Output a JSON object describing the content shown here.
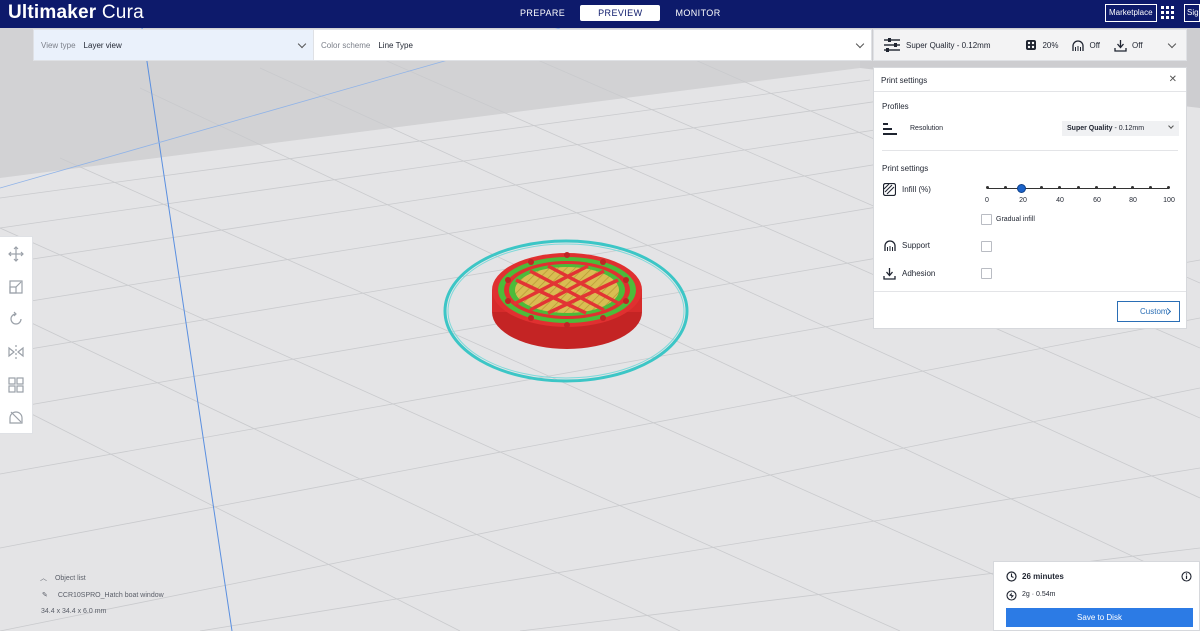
{
  "app": {
    "brand_bold": "Ultimaker",
    "brand_light": "Cura"
  },
  "stages": [
    {
      "label": "PREPARE",
      "active": false
    },
    {
      "label": "PREVIEW",
      "active": true
    },
    {
      "label": "MONITOR",
      "active": false
    }
  ],
  "header_right": {
    "marketplace": "Marketplace",
    "sign_in": "Sign in"
  },
  "view_toolbar": {
    "view_type_label": "View type",
    "view_type_value": "Layer view",
    "color_scheme_label": "Color scheme",
    "color_scheme_value": "Line Type"
  },
  "print_header": {
    "profile": "Super Quality - 0.12mm",
    "infill": "20%",
    "support": "Off",
    "adhesion": "Off"
  },
  "print_settings": {
    "title": "Print settings",
    "profiles_heading": "Profiles",
    "resolution_label": "Resolution",
    "resolution_value_bold": "Super Quality",
    "resolution_value_rest": " - 0.12mm",
    "settings_heading": "Print settings",
    "infill_label": "Infill (%)",
    "infill_value": 20,
    "infill_ticks": [
      "0",
      "20",
      "40",
      "60",
      "80",
      "100"
    ],
    "gradual_infill_label": "Gradual infill",
    "gradual_infill_checked": false,
    "support_label": "Support",
    "support_checked": false,
    "adhesion_label": "Adhesion",
    "adhesion_checked": false,
    "custom_button": "Custom"
  },
  "object_list": {
    "header": "Object list",
    "file_name": "CCR10SPRO_Hatch boat window",
    "dimensions": "34.4 x 34.4 x 6.0 mm"
  },
  "output": {
    "print_time": "26 minutes",
    "material": "2g · 0.54m",
    "save_button": "Save to Disk"
  },
  "colors": {
    "topbar": "#0d1a6b",
    "accent": "#2c7be5",
    "skirt": "#3cc6c6",
    "wall_outer": "#e02f2f",
    "wall_inner": "#4cbb3a",
    "infill": "#d6b84a"
  }
}
